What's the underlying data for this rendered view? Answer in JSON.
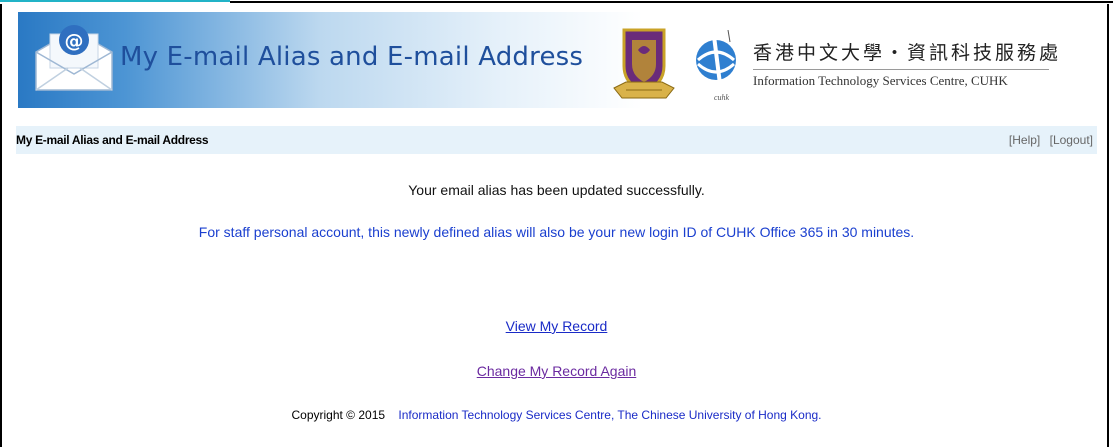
{
  "banner": {
    "title": "My E-mail Alias and E-mail Address",
    "org_name_cn": "香港中文大學‧資訊科技服務處",
    "org_name_en": "Information Technology Services Centre, CUHK"
  },
  "subbar": {
    "title": "My E-mail Alias and E-mail Address",
    "help_label": "[Help]",
    "logout_label": "[Logout]"
  },
  "main": {
    "success_message": "Your email alias has been updated successfully.",
    "info_message": "For staff personal account, this newly defined alias will also be your new login ID of CUHK Office 365 in 30 minutes.",
    "view_record_label": "View My Record",
    "change_record_label": "Change My Record Again"
  },
  "footer": {
    "copyright": "Copyright © 2015",
    "org": "Information Technology Services Centre, The Chinese University of Hong Kong."
  },
  "colors": {
    "banner_blue": "#2a79c4",
    "title_blue": "#1f4f9c",
    "info_blue": "#1a3fcf",
    "link_blue": "#1a2bc7",
    "visited_purple": "#6b2aa0",
    "subbar_bg": "#e6f2fa"
  },
  "icons": [
    "envelope-at-icon",
    "cuhk-crest-logo",
    "itsc-logo"
  ]
}
